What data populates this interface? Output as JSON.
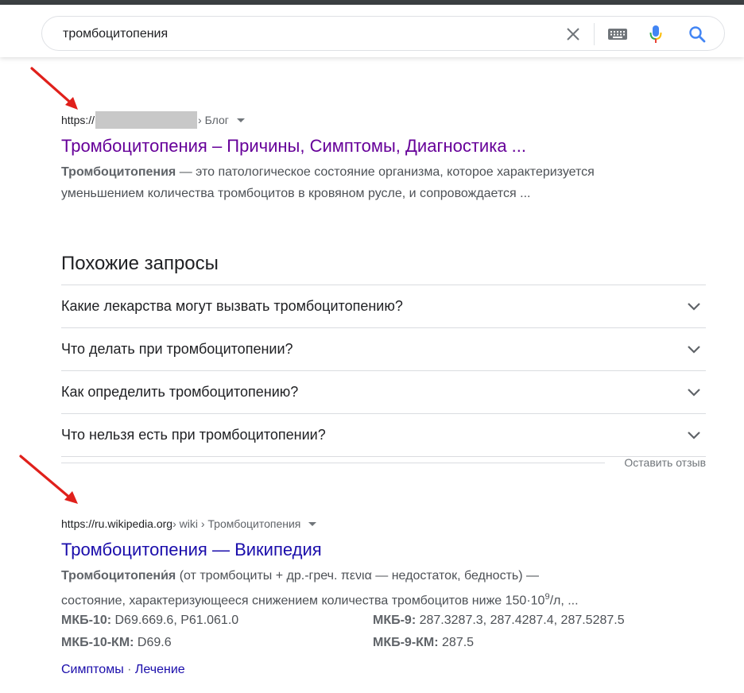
{
  "search": {
    "query": "тромбоцитопения",
    "icons": {
      "clear": "close-icon",
      "keyboard": "keyboard-icon",
      "mic": "mic-icon",
      "search": "search-icon"
    },
    "colors": {
      "mic_blue": "#4285f4",
      "mic_red": "#ea4335",
      "mic_yellow": "#fbbc04",
      "mic_green": "#34a853",
      "search_blue": "#4285f4"
    }
  },
  "result1": {
    "url_prefix": "https://",
    "url_path": "› Блог",
    "title": "Тромбоцитопения – Причины, Симптомы, Диагностика ...",
    "snippet_bold": "Тромбоцитопения",
    "snippet_text": " — это патологическое состояние организма, которое характеризуется уменьшением количества тромбоцитов в кровяном русле, и сопровождается ..."
  },
  "related": {
    "heading": "Похожие запросы",
    "items": [
      {
        "question": "Какие лекарства могут вызвать тромбоцитопению?"
      },
      {
        "question": "Что делать при тромбоцитопении?"
      },
      {
        "question": "Как определить тромбоцитопению?"
      },
      {
        "question": "Что нельзя есть при тромбоцитопении?"
      }
    ],
    "feedback": "Оставить отзыв"
  },
  "result2": {
    "url_domain": "https://ru.wikipedia.org",
    "url_path": " › wiki › Тромбоцитопения",
    "title": "Тромбоцитопения — Википедия",
    "snippet_bold": "Тромбоцитопени́я",
    "snippet_line1": " (от тромбоциты + др.-греч. πενια — недостаток, бедность) —",
    "snippet_line2_pre": "состояние, характеризующееся снижением количества тромбоцитов ниже 150·10",
    "snippet_sup": "9",
    "snippet_line2_post": "/л, ...",
    "facts": {
      "mkb10_label": "МКБ-10:",
      "mkb10_value": " D69.669.6, P61.061.0",
      "mkb10km_label": "МКБ-10-КМ:",
      "mkb10km_value": " D69.6",
      "mkb9_label": "МКБ-9:",
      "mkb9_value": " 287.3287.3, 287.4287.4, 287.5287.5",
      "mkb9km_label": "МКБ-9-КМ:",
      "mkb9km_value": " 287.5"
    },
    "sitelinks": {
      "link1": "Симптомы",
      "separator": " · ",
      "link2": "Лечение"
    }
  },
  "annotations": {
    "arrow_color": "#e0201b"
  }
}
